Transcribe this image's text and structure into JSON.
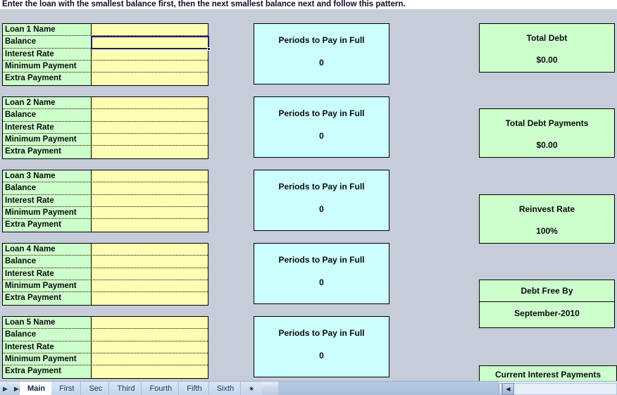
{
  "header": {
    "instruction": "Enter the loan with the smallest balance first, then the next smallest balance next and follow this pattern."
  },
  "loans": [
    {
      "name_label": "Loan 1 Name",
      "balance_label": "Balance",
      "interest_label": "Interest Rate",
      "minimum_label": "Minimum Payment",
      "extra_label": "Extra Payment",
      "name_value": "",
      "balance_value": "",
      "interest_value": "",
      "minimum_value": "",
      "extra_value": "",
      "periods_title": "Periods to Pay in Full",
      "periods_value": "0"
    },
    {
      "name_label": "Loan 2 Name",
      "balance_label": "Balance",
      "interest_label": "Interest Rate",
      "minimum_label": "Minimum Payment",
      "extra_label": "Extra Payment",
      "name_value": "",
      "balance_value": "",
      "interest_value": "",
      "minimum_value": "",
      "extra_value": "",
      "periods_title": "Periods to Pay in Full",
      "periods_value": "0"
    },
    {
      "name_label": "Loan 3 Name",
      "balance_label": "Balance",
      "interest_label": "Interest Rate",
      "minimum_label": "Minimum Payment",
      "extra_label": "Extra Payment",
      "name_value": "",
      "balance_value": "",
      "interest_value": "",
      "minimum_value": "",
      "extra_value": "",
      "periods_title": "Periods to Pay in Full",
      "periods_value": "0"
    },
    {
      "name_label": "Loan 4 Name",
      "balance_label": "Balance",
      "interest_label": "Interest Rate",
      "minimum_label": "Minimum Payment",
      "extra_label": "Extra Payment",
      "name_value": "",
      "balance_value": "",
      "interest_value": "",
      "minimum_value": "",
      "extra_value": "",
      "periods_title": "Periods to Pay in Full",
      "periods_value": "0"
    },
    {
      "name_label": "Loan 5 Name",
      "balance_label": "Balance",
      "interest_label": "Interest Rate",
      "minimum_label": "Minimum Payment",
      "extra_label": "Extra Payment",
      "name_value": "",
      "balance_value": "",
      "interest_value": "",
      "minimum_value": "",
      "extra_value": "",
      "periods_title": "Periods to Pay in Full",
      "periods_value": "0"
    }
  ],
  "summary": {
    "total_debt": {
      "title": "Total Debt",
      "value": "$0.00"
    },
    "total_debt_payments": {
      "title": "Total Debt Payments",
      "value": "$0.00"
    },
    "reinvest_rate": {
      "title": "Reinvest Rate",
      "value": "100%"
    },
    "debt_free_by": {
      "title": "Debt Free By",
      "value": "September-2010"
    },
    "current_interest_payments": {
      "title": "Current Interest Payments"
    }
  },
  "sheet_tabs": {
    "items": [
      {
        "label": "Main",
        "active": true
      },
      {
        "label": "First",
        "active": false
      },
      {
        "label": "Sec",
        "active": false
      },
      {
        "label": "Third",
        "active": false
      },
      {
        "label": "Fourth",
        "active": false
      },
      {
        "label": "Fifth",
        "active": false
      },
      {
        "label": "Sixth",
        "active": false
      }
    ],
    "new_sheet_icon": "✴",
    "nav_prev_icon": "▶",
    "nav_last_icon": "▶|",
    "scroll_left_icon": "◀"
  },
  "colors": {
    "label_green": "#ccffcc",
    "input_yellow": "#ffffb3",
    "periods_cyan": "#ccffff",
    "summary_green": "#ccffcc",
    "border_black": "#000000",
    "gridline": "#c6ccd8",
    "selection": "#1f1f6b"
  }
}
